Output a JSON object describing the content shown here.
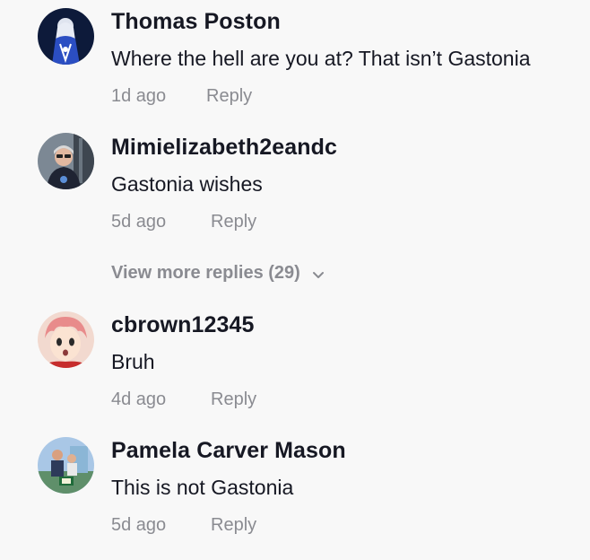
{
  "comments": [
    {
      "username": "Thomas Poston",
      "text": "Where the hell are you at? That isn’t Gastonia",
      "time": "1d ago",
      "reply_label": "Reply"
    },
    {
      "username": "Mimielizabeth2eandc",
      "text": "Gastonia wishes",
      "time": "5d ago",
      "reply_label": "Reply"
    },
    {
      "username": "cbrown12345",
      "text": "Bruh",
      "time": "4d ago",
      "reply_label": "Reply"
    },
    {
      "username": "Pamela Carver Mason",
      "text": "This is not Gastonia",
      "time": "5d ago",
      "reply_label": "Reply"
    }
  ],
  "view_more": {
    "label": "View more replies (29)",
    "icon": "chevron-down-icon"
  },
  "colors": {
    "background": "#f8f8f8",
    "primary_text": "#161823",
    "secondary_text": "#8a8b91"
  }
}
